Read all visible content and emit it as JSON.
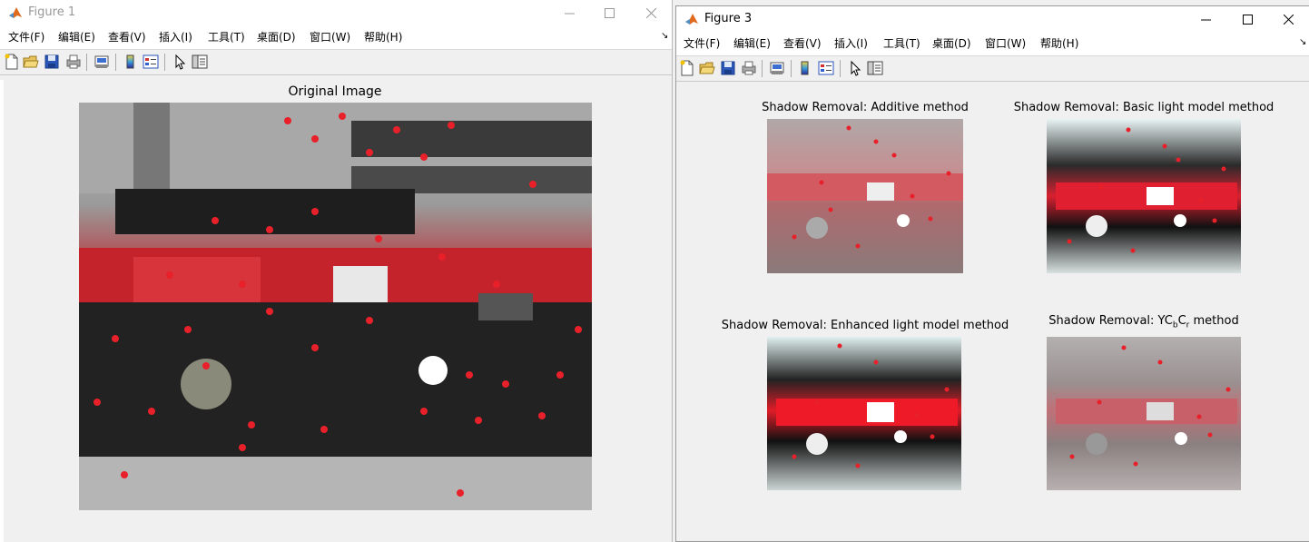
{
  "figure1": {
    "title": "Figure 1",
    "menu": [
      "文件(F)",
      "编辑(E)",
      "查看(V)",
      "插入(I)",
      "工具(T)",
      "桌面(D)",
      "窗口(W)",
      "帮助(H)"
    ],
    "axes_title": "Original Image"
  },
  "figure3": {
    "title": "Figure 3",
    "menu": [
      "文件(F)",
      "编辑(E)",
      "查看(V)",
      "插入(I)",
      "工具(T)",
      "桌面(D)",
      "窗口(W)",
      "帮助(H)"
    ],
    "subplots": [
      {
        "title": "Shadow Removal: Additive method"
      },
      {
        "title": "Shadow Removal: Basic light model method"
      },
      {
        "title": "Shadow Removal: Enhanced light model method"
      },
      {
        "title_prefix": "Shadow Removal: YC",
        "sub1": "b",
        "mid": "C",
        "sub2": "r",
        "suffix": " method"
      }
    ]
  },
  "icons": [
    "new-file",
    "open-folder",
    "save",
    "print",
    "print-preview",
    "colorbar",
    "legend",
    "pointer",
    "property-editor"
  ],
  "colors": {
    "marker": "#e8202a",
    "title_active": "#000000",
    "title_inactive": "#999999"
  }
}
